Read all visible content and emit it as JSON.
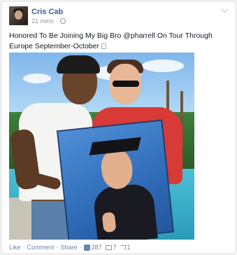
{
  "post": {
    "author": "Cris Cab",
    "time": "21 mins",
    "meta_separator": "·",
    "text": "Honored To Be Joining My Big Bro @pharrell On Tour Through Europe September-October"
  },
  "actions": {
    "like": "Like",
    "comment": "Comment",
    "share": "Share",
    "separator": "·",
    "like_count": "287",
    "comment_count": "7",
    "share_count": "1"
  },
  "colors": {
    "link_blue": "#3b5998",
    "meta_gray": "#9197a3",
    "border": "#d3d6db"
  },
  "icons": [
    "chevron-down-icon",
    "globe-icon",
    "language-icon",
    "like-icon",
    "comment-icon",
    "share-icon"
  ]
}
